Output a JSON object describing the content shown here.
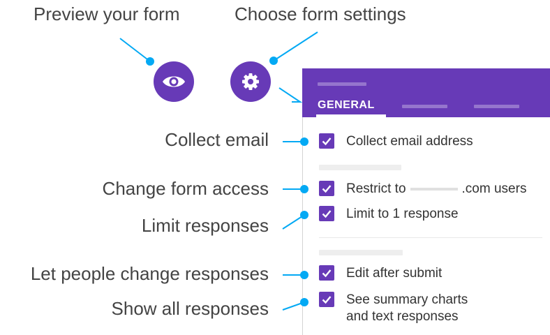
{
  "callouts": {
    "preview": "Preview your form",
    "settings": "Choose form settings",
    "collect_email": "Collect email",
    "change_access": "Change form access",
    "limit_responses": "Limit responses",
    "change_responses": "Let people change responses",
    "show_responses": "Show all responses"
  },
  "icons": {
    "preview": "eye-icon",
    "settings": "gear-icon"
  },
  "panel": {
    "active_tab": "GENERAL",
    "options": {
      "collect_email": {
        "label": "Collect email address",
        "checked": true
      },
      "restrict": {
        "label_before": "Restrict to",
        "label_after": ".com users",
        "checked": true
      },
      "limit": {
        "label": "Limit to 1 response",
        "checked": true
      },
      "edit_after": {
        "label": "Edit after submit",
        "checked": true
      },
      "summary": {
        "label_line1": "See summary charts",
        "label_line2": "and text responses",
        "checked": true
      }
    }
  },
  "colors": {
    "accent": "#673ab7",
    "connector": "#03a9f4",
    "text": "#444444"
  }
}
